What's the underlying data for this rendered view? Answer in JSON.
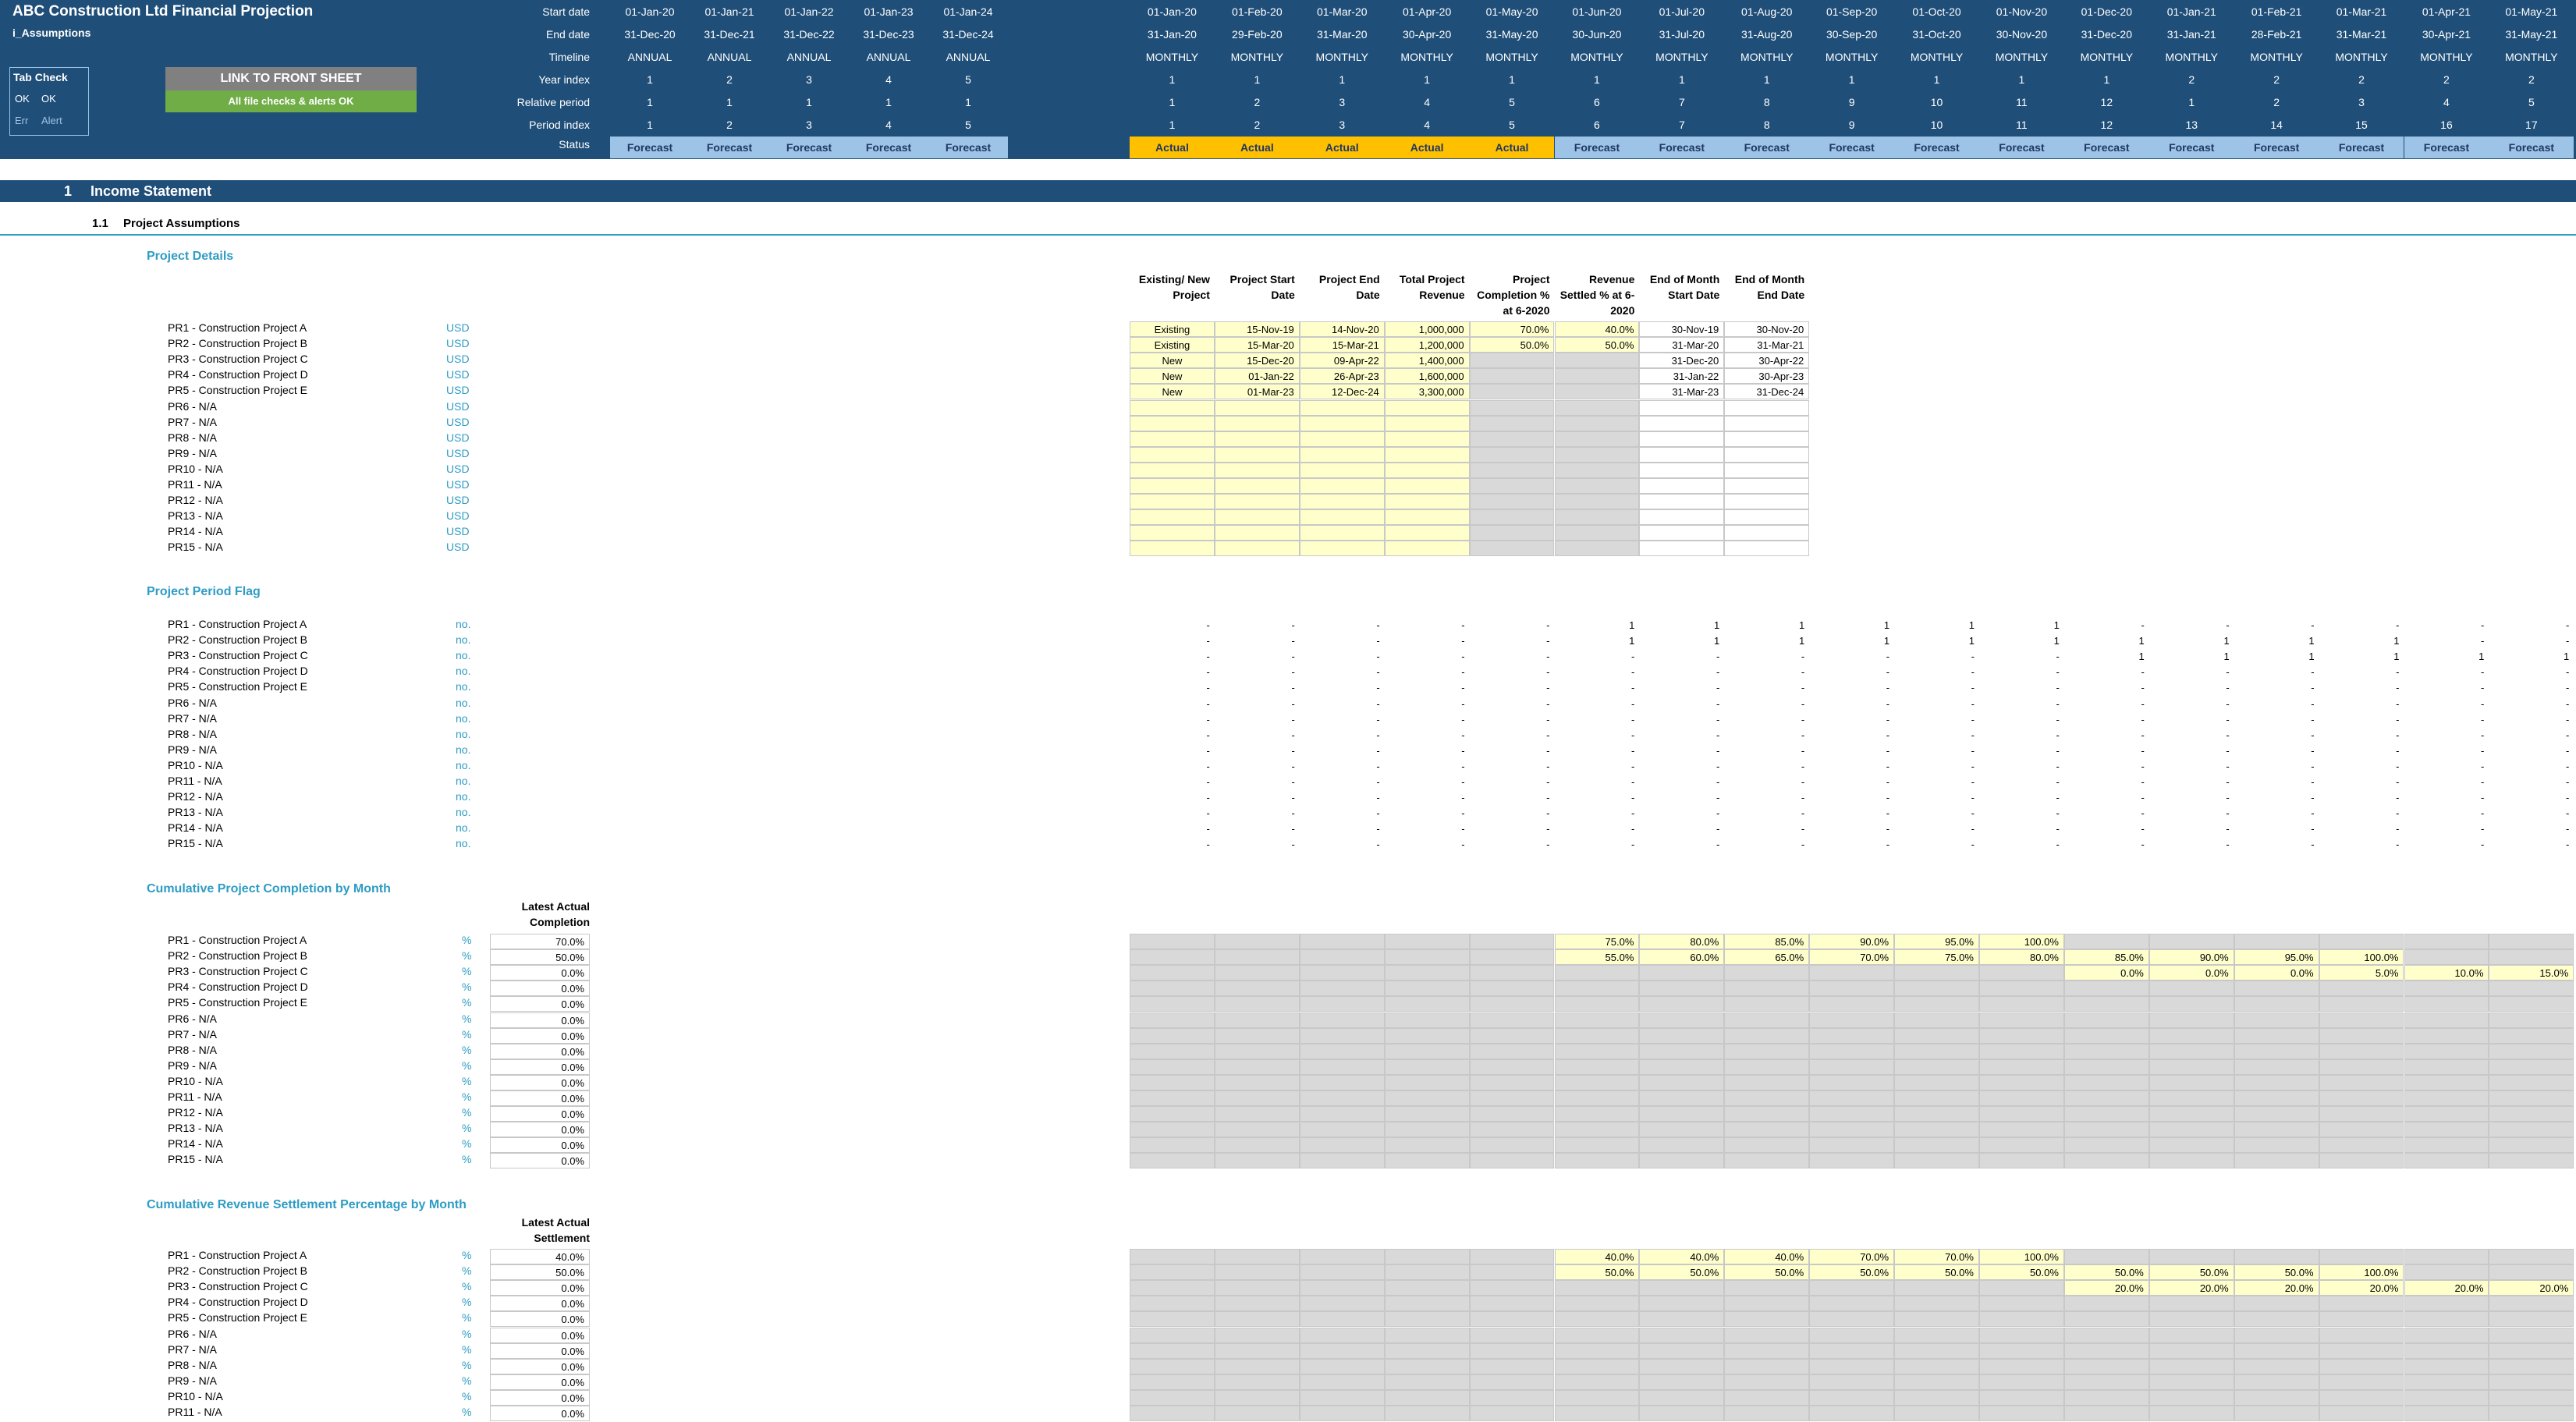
{
  "header": {
    "title": "ABC Construction Ltd Financial Projection",
    "sheet": "i_Assumptions",
    "row_labels": [
      "Start date",
      "End date",
      "Timeline",
      "Year index",
      "Relative period",
      "Period index",
      "Status"
    ],
    "tab_check": {
      "title": "Tab Check",
      "ok1": "OK",
      "ok2": "OK",
      "err": "Err",
      "alert": "Alert"
    },
    "link_button": "LINK TO FRONT SHEET",
    "checks_banner": "All file checks & alerts OK",
    "annual_columns": [
      {
        "start": "01-Jan-20",
        "end": "31-Dec-20",
        "timeline": "ANNUAL",
        "year": "1",
        "rel": "1",
        "period": "1",
        "status": "Forecast"
      },
      {
        "start": "01-Jan-21",
        "end": "31-Dec-21",
        "timeline": "ANNUAL",
        "year": "2",
        "rel": "1",
        "period": "2",
        "status": "Forecast"
      },
      {
        "start": "01-Jan-22",
        "end": "31-Dec-22",
        "timeline": "ANNUAL",
        "year": "3",
        "rel": "1",
        "period": "3",
        "status": "Forecast"
      },
      {
        "start": "01-Jan-23",
        "end": "31-Dec-23",
        "timeline": "ANNUAL",
        "year": "4",
        "rel": "1",
        "period": "4",
        "status": "Forecast"
      },
      {
        "start": "01-Jan-24",
        "end": "31-Dec-24",
        "timeline": "ANNUAL",
        "year": "5",
        "rel": "1",
        "period": "5",
        "status": "Forecast"
      }
    ],
    "monthly_columns": [
      {
        "start": "01-Jan-20",
        "end": "31-Jan-20",
        "timeline": "MONTHLY",
        "year": "1",
        "rel": "1",
        "period": "1",
        "status": "Actual"
      },
      {
        "start": "01-Feb-20",
        "end": "29-Feb-20",
        "timeline": "MONTHLY",
        "year": "1",
        "rel": "2",
        "period": "2",
        "status": "Actual"
      },
      {
        "start": "01-Mar-20",
        "end": "31-Mar-20",
        "timeline": "MONTHLY",
        "year": "1",
        "rel": "3",
        "period": "3",
        "status": "Actual"
      },
      {
        "start": "01-Apr-20",
        "end": "30-Apr-20",
        "timeline": "MONTHLY",
        "year": "1",
        "rel": "4",
        "period": "4",
        "status": "Actual"
      },
      {
        "start": "01-May-20",
        "end": "31-May-20",
        "timeline": "MONTHLY",
        "year": "1",
        "rel": "5",
        "period": "5",
        "status": "Actual"
      },
      {
        "start": "01-Jun-20",
        "end": "30-Jun-20",
        "timeline": "MONTHLY",
        "year": "1",
        "rel": "6",
        "period": "6",
        "status": "Forecast"
      },
      {
        "start": "01-Jul-20",
        "end": "31-Jul-20",
        "timeline": "MONTHLY",
        "year": "1",
        "rel": "7",
        "period": "7",
        "status": "Forecast"
      },
      {
        "start": "01-Aug-20",
        "end": "31-Aug-20",
        "timeline": "MONTHLY",
        "year": "1",
        "rel": "8",
        "period": "8",
        "status": "Forecast"
      },
      {
        "start": "01-Sep-20",
        "end": "30-Sep-20",
        "timeline": "MONTHLY",
        "year": "1",
        "rel": "9",
        "period": "9",
        "status": "Forecast"
      },
      {
        "start": "01-Oct-20",
        "end": "31-Oct-20",
        "timeline": "MONTHLY",
        "year": "1",
        "rel": "10",
        "period": "10",
        "status": "Forecast"
      },
      {
        "start": "01-Nov-20",
        "end": "30-Nov-20",
        "timeline": "MONTHLY",
        "year": "1",
        "rel": "11",
        "period": "11",
        "status": "Forecast"
      },
      {
        "start": "01-Dec-20",
        "end": "31-Dec-20",
        "timeline": "MONTHLY",
        "year": "1",
        "rel": "12",
        "period": "12",
        "status": "Forecast"
      },
      {
        "start": "01-Jan-21",
        "end": "31-Jan-21",
        "timeline": "MONTHLY",
        "year": "2",
        "rel": "1",
        "period": "13",
        "status": "Forecast"
      },
      {
        "start": "01-Feb-21",
        "end": "28-Feb-21",
        "timeline": "MONTHLY",
        "year": "2",
        "rel": "2",
        "period": "14",
        "status": "Forecast"
      },
      {
        "start": "01-Mar-21",
        "end": "31-Mar-21",
        "timeline": "MONTHLY",
        "year": "2",
        "rel": "3",
        "period": "15",
        "status": "Forecast"
      },
      {
        "start": "01-Apr-21",
        "end": "30-Apr-21",
        "timeline": "MONTHLY",
        "year": "2",
        "rel": "4",
        "period": "16",
        "status": "Forecast"
      },
      {
        "start": "01-May-21",
        "end": "31-May-21",
        "timeline": "MONTHLY",
        "year": "2",
        "rel": "5",
        "period": "17",
        "status": "Forecast"
      }
    ]
  },
  "section": {
    "number": "1",
    "title": "Income Statement",
    "sub_number": "1.1",
    "sub_title": "Project Assumptions"
  },
  "project_names": [
    "PR1 - Construction Project A",
    "PR2 - Construction Project B",
    "PR3 - Construction Project C",
    "PR4 - Construction Project D",
    "PR5 - Construction Project E",
    "PR6 - N/A",
    "PR7 - N/A",
    "PR8 - N/A",
    "PR9 - N/A",
    "PR10 - N/A",
    "PR11 - N/A",
    "PR12 - N/A",
    "PR13 - N/A",
    "PR14 - N/A",
    "PR15 - N/A"
  ],
  "project_details": {
    "title": "Project Details",
    "unit": "USD",
    "columns": [
      "Existing/ New Project",
      "Project Start Date",
      "Project End Date",
      "Total Project Revenue",
      "Project Completion % at 6-2020",
      "Revenue Settled % at 6-2020",
      "End of Month Start Date",
      "End of Month End Date"
    ],
    "rows": [
      [
        "Existing",
        "15-Nov-19",
        "14-Nov-20",
        "1,000,000",
        "70.0%",
        "40.0%",
        "30-Nov-19",
        "30-Nov-20"
      ],
      [
        "Existing",
        "15-Mar-20",
        "15-Mar-21",
        "1,200,000",
        "50.0%",
        "50.0%",
        "31-Mar-20",
        "31-Mar-21"
      ],
      [
        "New",
        "15-Dec-20",
        "09-Apr-22",
        "1,400,000",
        "",
        "",
        "31-Dec-20",
        "30-Apr-22"
      ],
      [
        "New",
        "01-Jan-22",
        "26-Apr-23",
        "1,600,000",
        "",
        "",
        "31-Jan-22",
        "30-Apr-23"
      ],
      [
        "New",
        "01-Mar-23",
        "12-Dec-24",
        "3,300,000",
        "",
        "",
        "31-Mar-23",
        "31-Dec-24"
      ]
    ]
  },
  "period_flag": {
    "title": "Project Period Flag",
    "unit": "no.",
    "rows": [
      [
        "-",
        "-",
        "-",
        "-",
        "-",
        "1",
        "1",
        "1",
        "1",
        "1",
        "1",
        "-",
        "-",
        "-",
        "-",
        "-",
        "-"
      ],
      [
        "-",
        "-",
        "-",
        "-",
        "-",
        "1",
        "1",
        "1",
        "1",
        "1",
        "1",
        "1",
        "1",
        "1",
        "1",
        "-",
        "-"
      ],
      [
        "-",
        "-",
        "-",
        "-",
        "-",
        "-",
        "-",
        "-",
        "-",
        "-",
        "-",
        "1",
        "1",
        "1",
        "1",
        "1",
        "1"
      ],
      [
        "-",
        "-",
        "-",
        "-",
        "-",
        "-",
        "-",
        "-",
        "-",
        "-",
        "-",
        "-",
        "-",
        "-",
        "-",
        "-",
        "-"
      ],
      [
        "-",
        "-",
        "-",
        "-",
        "-",
        "-",
        "-",
        "-",
        "-",
        "-",
        "-",
        "-",
        "-",
        "-",
        "-",
        "-",
        "-"
      ],
      [
        "-",
        "-",
        "-",
        "-",
        "-",
        "-",
        "-",
        "-",
        "-",
        "-",
        "-",
        "-",
        "-",
        "-",
        "-",
        "-",
        "-"
      ],
      [
        "-",
        "-",
        "-",
        "-",
        "-",
        "-",
        "-",
        "-",
        "-",
        "-",
        "-",
        "-",
        "-",
        "-",
        "-",
        "-",
        "-"
      ],
      [
        "-",
        "-",
        "-",
        "-",
        "-",
        "-",
        "-",
        "-",
        "-",
        "-",
        "-",
        "-",
        "-",
        "-",
        "-",
        "-",
        "-"
      ],
      [
        "-",
        "-",
        "-",
        "-",
        "-",
        "-",
        "-",
        "-",
        "-",
        "-",
        "-",
        "-",
        "-",
        "-",
        "-",
        "-",
        "-"
      ],
      [
        "-",
        "-",
        "-",
        "-",
        "-",
        "-",
        "-",
        "-",
        "-",
        "-",
        "-",
        "-",
        "-",
        "-",
        "-",
        "-",
        "-"
      ],
      [
        "-",
        "-",
        "-",
        "-",
        "-",
        "-",
        "-",
        "-",
        "-",
        "-",
        "-",
        "-",
        "-",
        "-",
        "-",
        "-",
        "-"
      ],
      [
        "-",
        "-",
        "-",
        "-",
        "-",
        "-",
        "-",
        "-",
        "-",
        "-",
        "-",
        "-",
        "-",
        "-",
        "-",
        "-",
        "-"
      ],
      [
        "-",
        "-",
        "-",
        "-",
        "-",
        "-",
        "-",
        "-",
        "-",
        "-",
        "-",
        "-",
        "-",
        "-",
        "-",
        "-",
        "-"
      ],
      [
        "-",
        "-",
        "-",
        "-",
        "-",
        "-",
        "-",
        "-",
        "-",
        "-",
        "-",
        "-",
        "-",
        "-",
        "-",
        "-",
        "-"
      ],
      [
        "-",
        "-",
        "-",
        "-",
        "-",
        "-",
        "-",
        "-",
        "-",
        "-",
        "-",
        "-",
        "-",
        "-",
        "-",
        "-",
        "-"
      ]
    ]
  },
  "completion": {
    "title": "Cumulative Project Completion by Month",
    "unit": "%",
    "latest_header": "Latest Actual Completion",
    "latest": [
      "70.0%",
      "50.0%",
      "0.0%",
      "0.0%",
      "0.0%",
      "0.0%",
      "0.0%",
      "0.0%",
      "0.0%",
      "0.0%",
      "0.0%",
      "0.0%",
      "0.0%",
      "0.0%",
      "0.0%"
    ],
    "rows": [
      [
        "",
        "",
        "",
        "",
        "",
        "75.0%",
        "80.0%",
        "85.0%",
        "90.0%",
        "95.0%",
        "100.0%",
        "",
        "",
        "",
        "",
        "",
        ""
      ],
      [
        "",
        "",
        "",
        "",
        "",
        "55.0%",
        "60.0%",
        "65.0%",
        "70.0%",
        "75.0%",
        "80.0%",
        "85.0%",
        "90.0%",
        "95.0%",
        "100.0%",
        "",
        ""
      ],
      [
        "",
        "",
        "",
        "",
        "",
        "",
        "",
        "",
        "",
        "",
        "",
        "0.0%",
        "0.0%",
        "0.0%",
        "5.0%",
        "10.0%",
        "15.0%"
      ]
    ]
  },
  "settlement": {
    "title": "Cumulative Revenue Settlement Percentage by Month",
    "unit": "%",
    "latest_header": "Latest Actual Settlement",
    "latest": [
      "40.0%",
      "50.0%",
      "0.0%",
      "0.0%",
      "0.0%",
      "0.0%",
      "0.0%",
      "0.0%",
      "0.0%",
      "0.0%",
      "0.0%"
    ],
    "rows": [
      [
        "",
        "",
        "",
        "",
        "",
        "40.0%",
        "40.0%",
        "40.0%",
        "70.0%",
        "70.0%",
        "100.0%",
        "",
        "",
        "",
        "",
        "",
        ""
      ],
      [
        "",
        "",
        "",
        "",
        "",
        "50.0%",
        "50.0%",
        "50.0%",
        "50.0%",
        "50.0%",
        "50.0%",
        "50.0%",
        "50.0%",
        "50.0%",
        "100.0%",
        "",
        ""
      ],
      [
        "",
        "",
        "",
        "",
        "",
        "",
        "",
        "",
        "",
        "",
        "",
        "20.0%",
        "20.0%",
        "20.0%",
        "20.0%",
        "20.0%",
        "20.0%"
      ]
    ]
  },
  "colors": {
    "header_bg": "#1f4e78",
    "forecast": "#9dc3e6",
    "actual": "#ffc000",
    "input": "#ffffcc",
    "locked": "#d9d9d9",
    "accent": "#2e9cc4",
    "green": "#70ad47"
  }
}
